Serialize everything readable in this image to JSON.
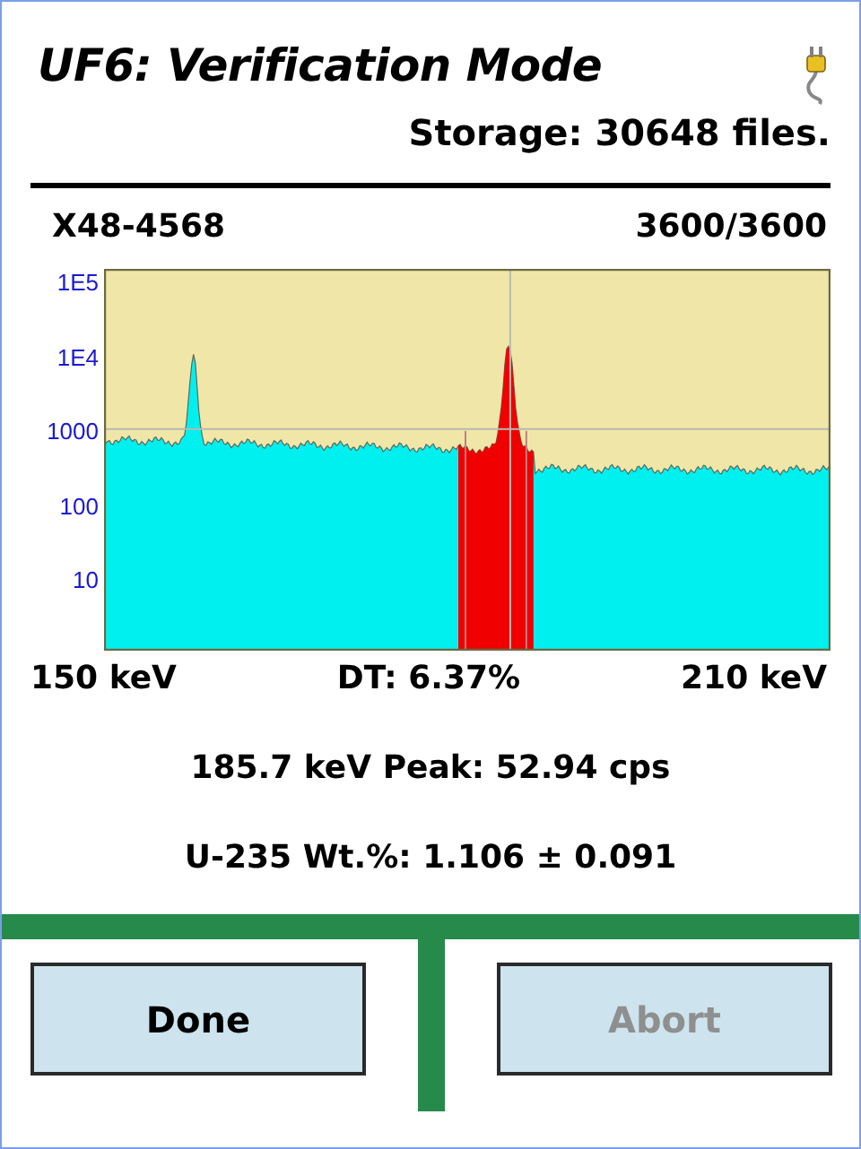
{
  "title": "UF6: Verification Mode",
  "storage": "Storage: 30648 files.",
  "sample_id": "X48-4568",
  "count_progress": "3600/3600",
  "spectrum": {
    "y_tick_labels": [
      "1E5",
      "1E4",
      "1000",
      "100",
      "10"
    ],
    "x_start_label": "150 keV",
    "dead_time": "DT: 6.37%",
    "x_end_label": "210 keV"
  },
  "peak": "185.7 keV Peak: 52.94 cps",
  "enrichment": "U-235 Wt.%: 1.106 ± 0.091",
  "buttons": [
    {
      "label": "Done",
      "disabled": false
    },
    {
      "label": "Abort",
      "disabled": true
    }
  ]
}
